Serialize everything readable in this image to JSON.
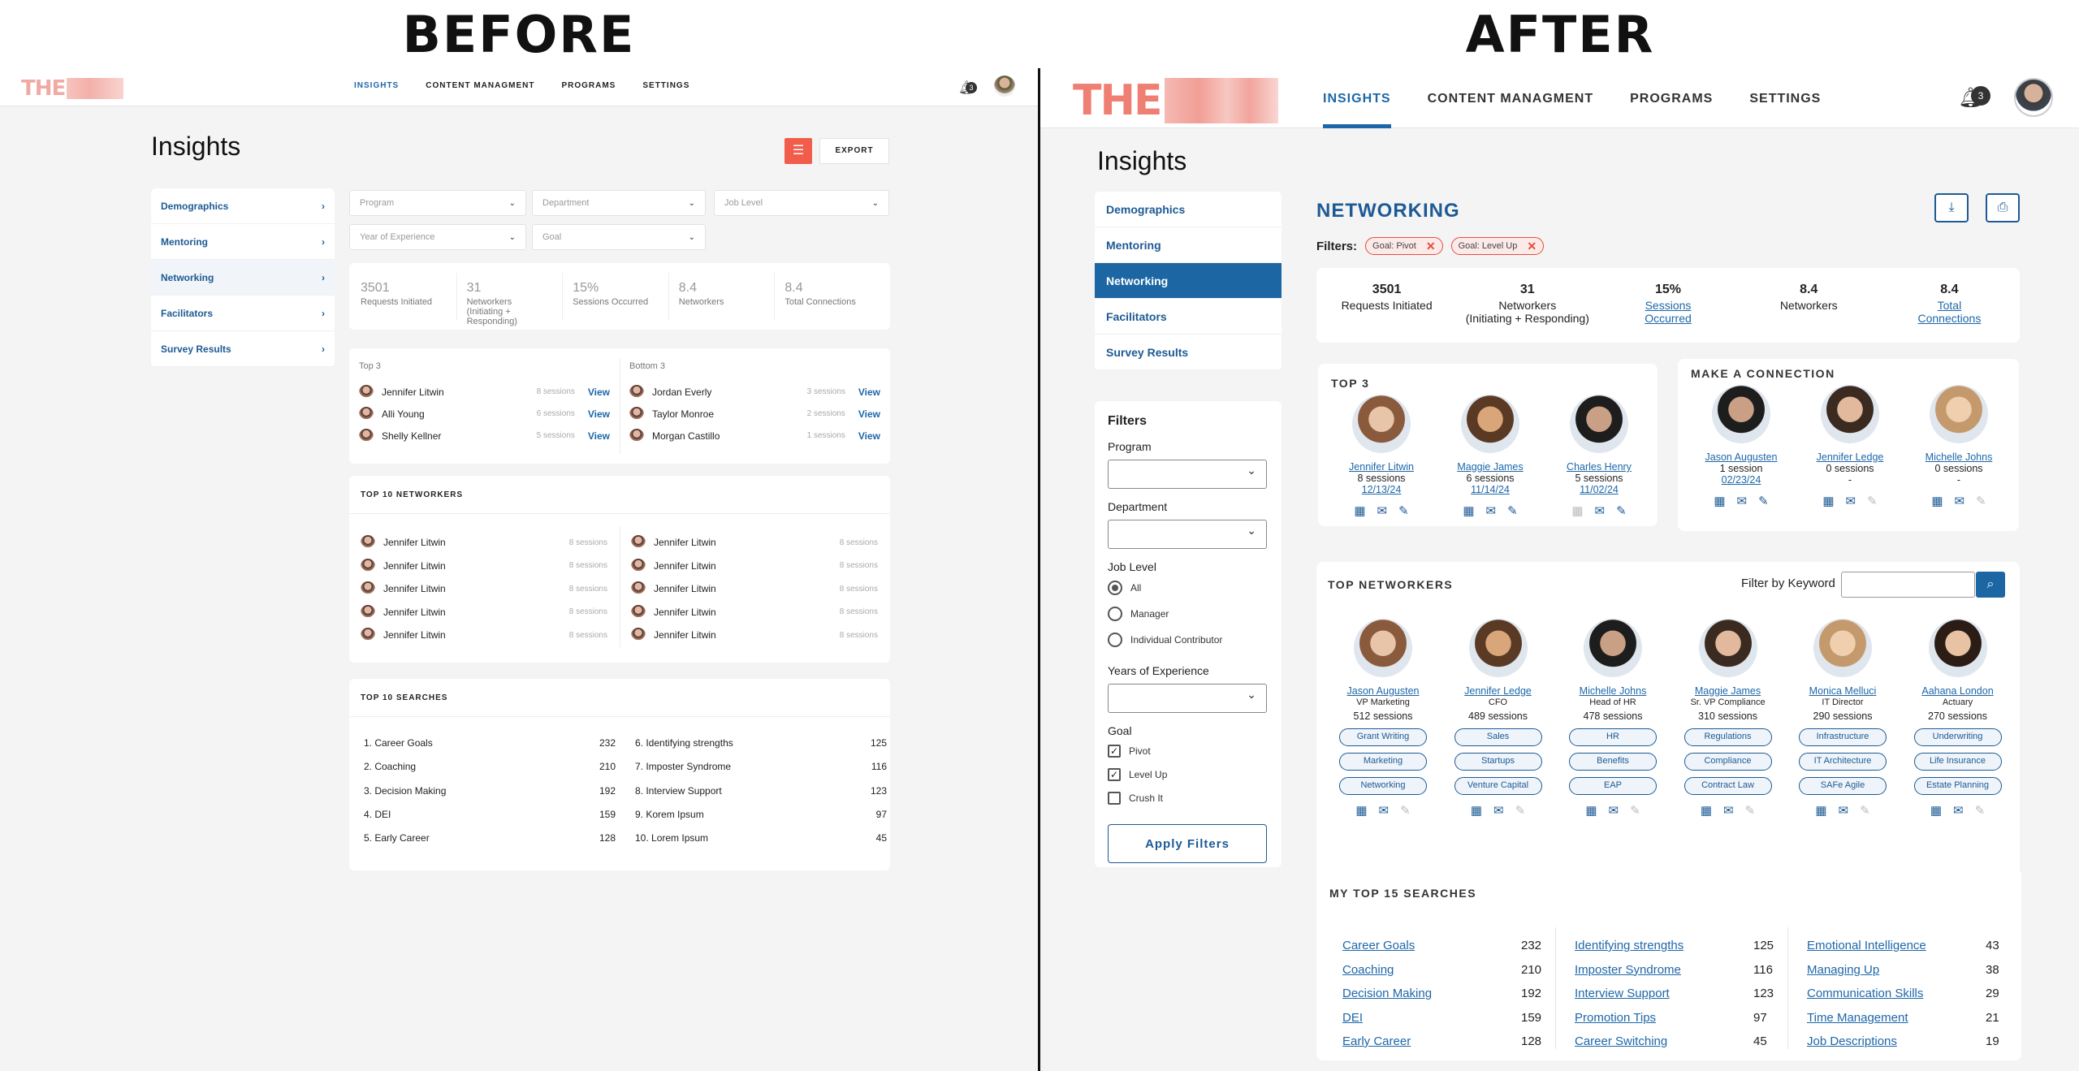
{
  "labels": {
    "before": "BEFORE",
    "after": "AFTER"
  },
  "before": {
    "logo": "THE",
    "nav": [
      "INSIGHTS",
      "CONTENT MANAGMENT",
      "PROGRAMS",
      "SETTINGS"
    ],
    "notif_count": "3",
    "page_title": "Insights",
    "export_label": "EXPORT",
    "sidebar": [
      "Demographics",
      "Mentoring",
      "Networking",
      "Facilitators",
      "Survey Results"
    ],
    "selects": [
      "Program",
      "Department",
      "Job Level",
      "Year of Experience",
      "Goal"
    ],
    "stats": [
      {
        "n": "3501",
        "l": "Requests Initiated"
      },
      {
        "n": "31",
        "l": "Networkers\n(Initiating + Responding)"
      },
      {
        "n": "15%",
        "l": "Sessions Occurred"
      },
      {
        "n": "8.4",
        "l": "Networkers"
      },
      {
        "n": "8.4",
        "l": "Total Connections"
      }
    ],
    "top3_label": "Top 3",
    "bottom3_label": "Bottom 3",
    "top3": [
      {
        "name": "Jennifer Litwin",
        "sessions": "8 sessions",
        "action": "View"
      },
      {
        "name": "Alli Young",
        "sessions": "6 sessions",
        "action": "View"
      },
      {
        "name": "Shelly Kellner",
        "sessions": "5 sessions",
        "action": "View"
      }
    ],
    "bottom3": [
      {
        "name": "Jordan Everly",
        "sessions": "3 sessions",
        "action": "View"
      },
      {
        "name": "Taylor Monroe",
        "sessions": "2 sessions",
        "action": "View"
      },
      {
        "name": "Morgan Castillo",
        "sessions": "1 sessions",
        "action": "View"
      }
    ],
    "top_networkers_title": "TOP 10 NETWORKERS",
    "networkers_left": [
      {
        "name": "Jennifer Litwin",
        "sessions": "8 sessions"
      },
      {
        "name": "Jennifer Litwin",
        "sessions": "8 sessions"
      },
      {
        "name": "Jennifer Litwin",
        "sessions": "8 sessions"
      },
      {
        "name": "Jennifer Litwin",
        "sessions": "8 sessions"
      },
      {
        "name": "Jennifer Litwin",
        "sessions": "8 sessions"
      }
    ],
    "networkers_right": [
      {
        "name": "Jennifer Litwin",
        "sessions": "8 sessions"
      },
      {
        "name": "Jennifer Litwin",
        "sessions": "8 sessions"
      },
      {
        "name": "Jennifer Litwin",
        "sessions": "8 sessions"
      },
      {
        "name": "Jennifer Litwin",
        "sessions": "8 sessions"
      },
      {
        "name": "Jennifer Litwin",
        "sessions": "8 sessions"
      }
    ],
    "top_searches_title": "TOP 10 SEARCHES",
    "searches_left": [
      {
        "q": "1. Career Goals",
        "c": "232"
      },
      {
        "q": "2. Coaching",
        "c": "210"
      },
      {
        "q": "3. Decision Making",
        "c": "192"
      },
      {
        "q": "4. DEI",
        "c": "159"
      },
      {
        "q": "5. Early Career",
        "c": "128"
      }
    ],
    "searches_right": [
      {
        "q": "6. Identifying strengths",
        "c": "125"
      },
      {
        "q": "7. Imposter Syndrome",
        "c": "116"
      },
      {
        "q": "8. Interview Support",
        "c": "123"
      },
      {
        "q": "9. Korem Ipsum",
        "c": "97"
      },
      {
        "q": "10. Lorem Ipsum",
        "c": "45"
      }
    ]
  },
  "after": {
    "logo": "THE",
    "nav": [
      "INSIGHTS",
      "CONTENT MANAGMENT",
      "PROGRAMS",
      "SETTINGS"
    ],
    "notif_count": "3",
    "page_title": "Insights",
    "sidebar": [
      "Demographics",
      "Mentoring",
      "Networking",
      "Facilitators",
      "Survey Results"
    ],
    "filters": {
      "title": "Filters",
      "program_label": "Program",
      "department_label": "Department",
      "job_level_label": "Job Level",
      "job_levels": [
        "All",
        "Manager",
        "Individual Contributor"
      ],
      "yoe_label": "Years of Experience",
      "goal_label": "Goal",
      "goals": [
        {
          "label": "Pivot",
          "checked": true
        },
        {
          "label": "Level Up",
          "checked": true
        },
        {
          "label": "Crush It",
          "checked": false
        }
      ],
      "apply_label": "Apply Filters"
    },
    "section_title": "NETWORKING",
    "filters_label": "Filters:",
    "chips": [
      "Goal: Pivot",
      "Goal: Level Up"
    ],
    "stats": [
      {
        "n": "3501",
        "l": "Requests Initiated",
        "link": false
      },
      {
        "n": "31",
        "l": "Networkers\n(Initiating + Responding)",
        "link": false
      },
      {
        "n": "15%",
        "l": "Sessions\nOccurred",
        "link": true
      },
      {
        "n": "8.4",
        "l": "Networkers",
        "link": false
      },
      {
        "n": "8.4",
        "l": "Total\nConnections",
        "link": true
      }
    ],
    "top3_title": "TOP 3",
    "top3": [
      {
        "name": "Jennifer Litwin",
        "sessions": "8 sessions",
        "date": "12/13/24"
      },
      {
        "name": "Maggie James",
        "sessions": "6 sessions",
        "date": "11/14/24"
      },
      {
        "name": "Charles Henry",
        "sessions": "5 sessions",
        "date": "11/02/24"
      }
    ],
    "connection_title": "MAKE A CONNECTION",
    "connections": [
      {
        "name": "Jason Augusten",
        "sessions": "1 session",
        "date": "02/23/24"
      },
      {
        "name": "Jennifer Ledge",
        "sessions": "0 sessions",
        "date": "-"
      },
      {
        "name": "Michelle Johns",
        "sessions": "0 sessions",
        "date": "-"
      }
    ],
    "top_networkers_title": "TOP NETWORKERS",
    "keyword_label": "Filter by Keyword",
    "networkers": [
      {
        "name": "Jason Augusten",
        "title": "VP Marketing",
        "sessions": "512 sessions",
        "tags": [
          "Grant Writing",
          "Marketing",
          "Networking"
        ]
      },
      {
        "name": "Jennifer Ledge",
        "title": "CFO",
        "sessions": "489 sessions",
        "tags": [
          "Sales",
          "Startups",
          "Venture Capital"
        ]
      },
      {
        "name": "Michelle Johns",
        "title": "Head of HR",
        "sessions": "478 sessions",
        "tags": [
          "HR",
          "Benefits",
          "EAP"
        ]
      },
      {
        "name": "Maggie James",
        "title": "Sr. VP Compliance",
        "sessions": "310 sessions",
        "tags": [
          "Regulations",
          "Compliance",
          "Contract Law"
        ]
      },
      {
        "name": "Monica Melluci",
        "title": "IT Director",
        "sessions": "290 sessions",
        "tags": [
          "Infrastructure",
          "IT Architecture",
          "SAFe Agile"
        ]
      },
      {
        "name": "Aahana London",
        "title": "Actuary",
        "sessions": "270 sessions",
        "tags": [
          "Underwriting",
          "Life Insurance",
          "Estate Planning"
        ]
      }
    ],
    "searches_title": "MY TOP 15 SEARCHES",
    "searches": [
      [
        {
          "q": "Career Goals",
          "c": "232"
        },
        {
          "q": "Coaching",
          "c": "210"
        },
        {
          "q": "Decision Making",
          "c": "192"
        },
        {
          "q": "DEI",
          "c": "159"
        },
        {
          "q": "Early Career",
          "c": "128"
        }
      ],
      [
        {
          "q": "Identifying strengths",
          "c": "125"
        },
        {
          "q": "Imposter Syndrome",
          "c": "116"
        },
        {
          "q": "Interview Support",
          "c": "123"
        },
        {
          "q": "Promotion Tips",
          "c": "97"
        },
        {
          "q": "Career Switching",
          "c": "45"
        }
      ],
      [
        {
          "q": "Emotional Intelligence",
          "c": "43"
        },
        {
          "q": "Managing Up",
          "c": "38"
        },
        {
          "q": "Communication Skills",
          "c": "29"
        },
        {
          "q": "Time Management",
          "c": "21"
        },
        {
          "q": "Job Descriptions",
          "c": "19"
        }
      ]
    ]
  }
}
